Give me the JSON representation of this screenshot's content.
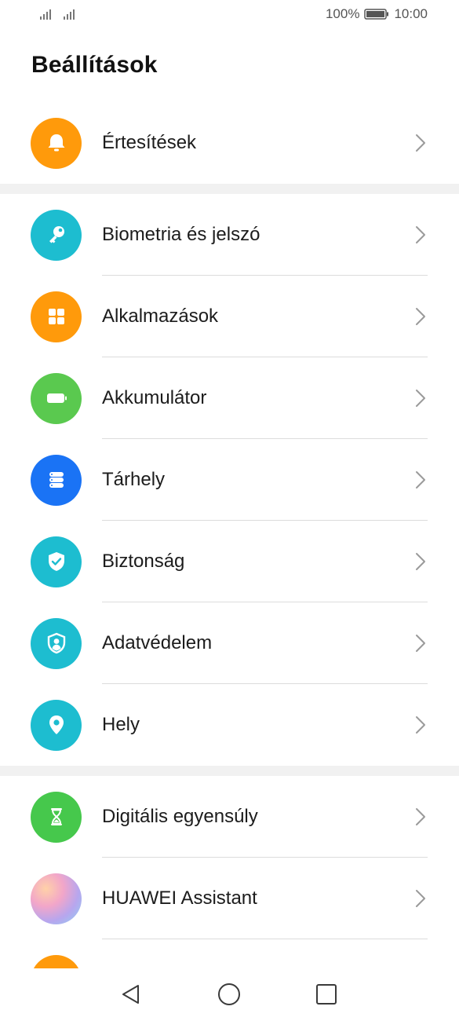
{
  "status_bar": {
    "battery_percent": "100%",
    "time": "10:00",
    "signal_icons": [
      "signal-icon",
      "signal-icon"
    ],
    "battery_icon": "battery-icon"
  },
  "header": {
    "title": "Beállítások"
  },
  "groups": [
    {
      "items": [
        {
          "label": "Értesítések",
          "icon": "bell-icon",
          "color": "#FF9A0B"
        }
      ]
    },
    {
      "items": [
        {
          "label": "Biometria és jelszó",
          "icon": "key-icon",
          "color": "#1DBDD0"
        },
        {
          "label": "Alkalmazások",
          "icon": "apps-grid-icon",
          "color": "#FF9A0B"
        },
        {
          "label": "Akkumulátor",
          "icon": "battery-icon",
          "color": "#5AC94F"
        },
        {
          "label": "Tárhely",
          "icon": "storage-icon",
          "color": "#1A73F5"
        },
        {
          "label": "Biztonság",
          "icon": "shield-check-icon",
          "color": "#1DBDD0"
        },
        {
          "label": "Adatvédelem",
          "icon": "privacy-shield-icon",
          "color": "#1DBDD0"
        },
        {
          "label": "Hely",
          "icon": "location-pin-icon",
          "color": "#1DBDD0"
        }
      ]
    },
    {
      "items": [
        {
          "label": "Digitális egyensúly",
          "icon": "hourglass-icon",
          "color": "#46C84C"
        },
        {
          "label": "HUAWEI Assistant",
          "icon": "assistant-icon",
          "color": "#E9A5C8"
        },
        {
          "label": "",
          "icon": "partial-icon",
          "color": "#FF9A0B"
        }
      ]
    }
  ],
  "nav_bar": {
    "buttons": [
      "back-icon",
      "home-icon",
      "recents-icon"
    ]
  }
}
